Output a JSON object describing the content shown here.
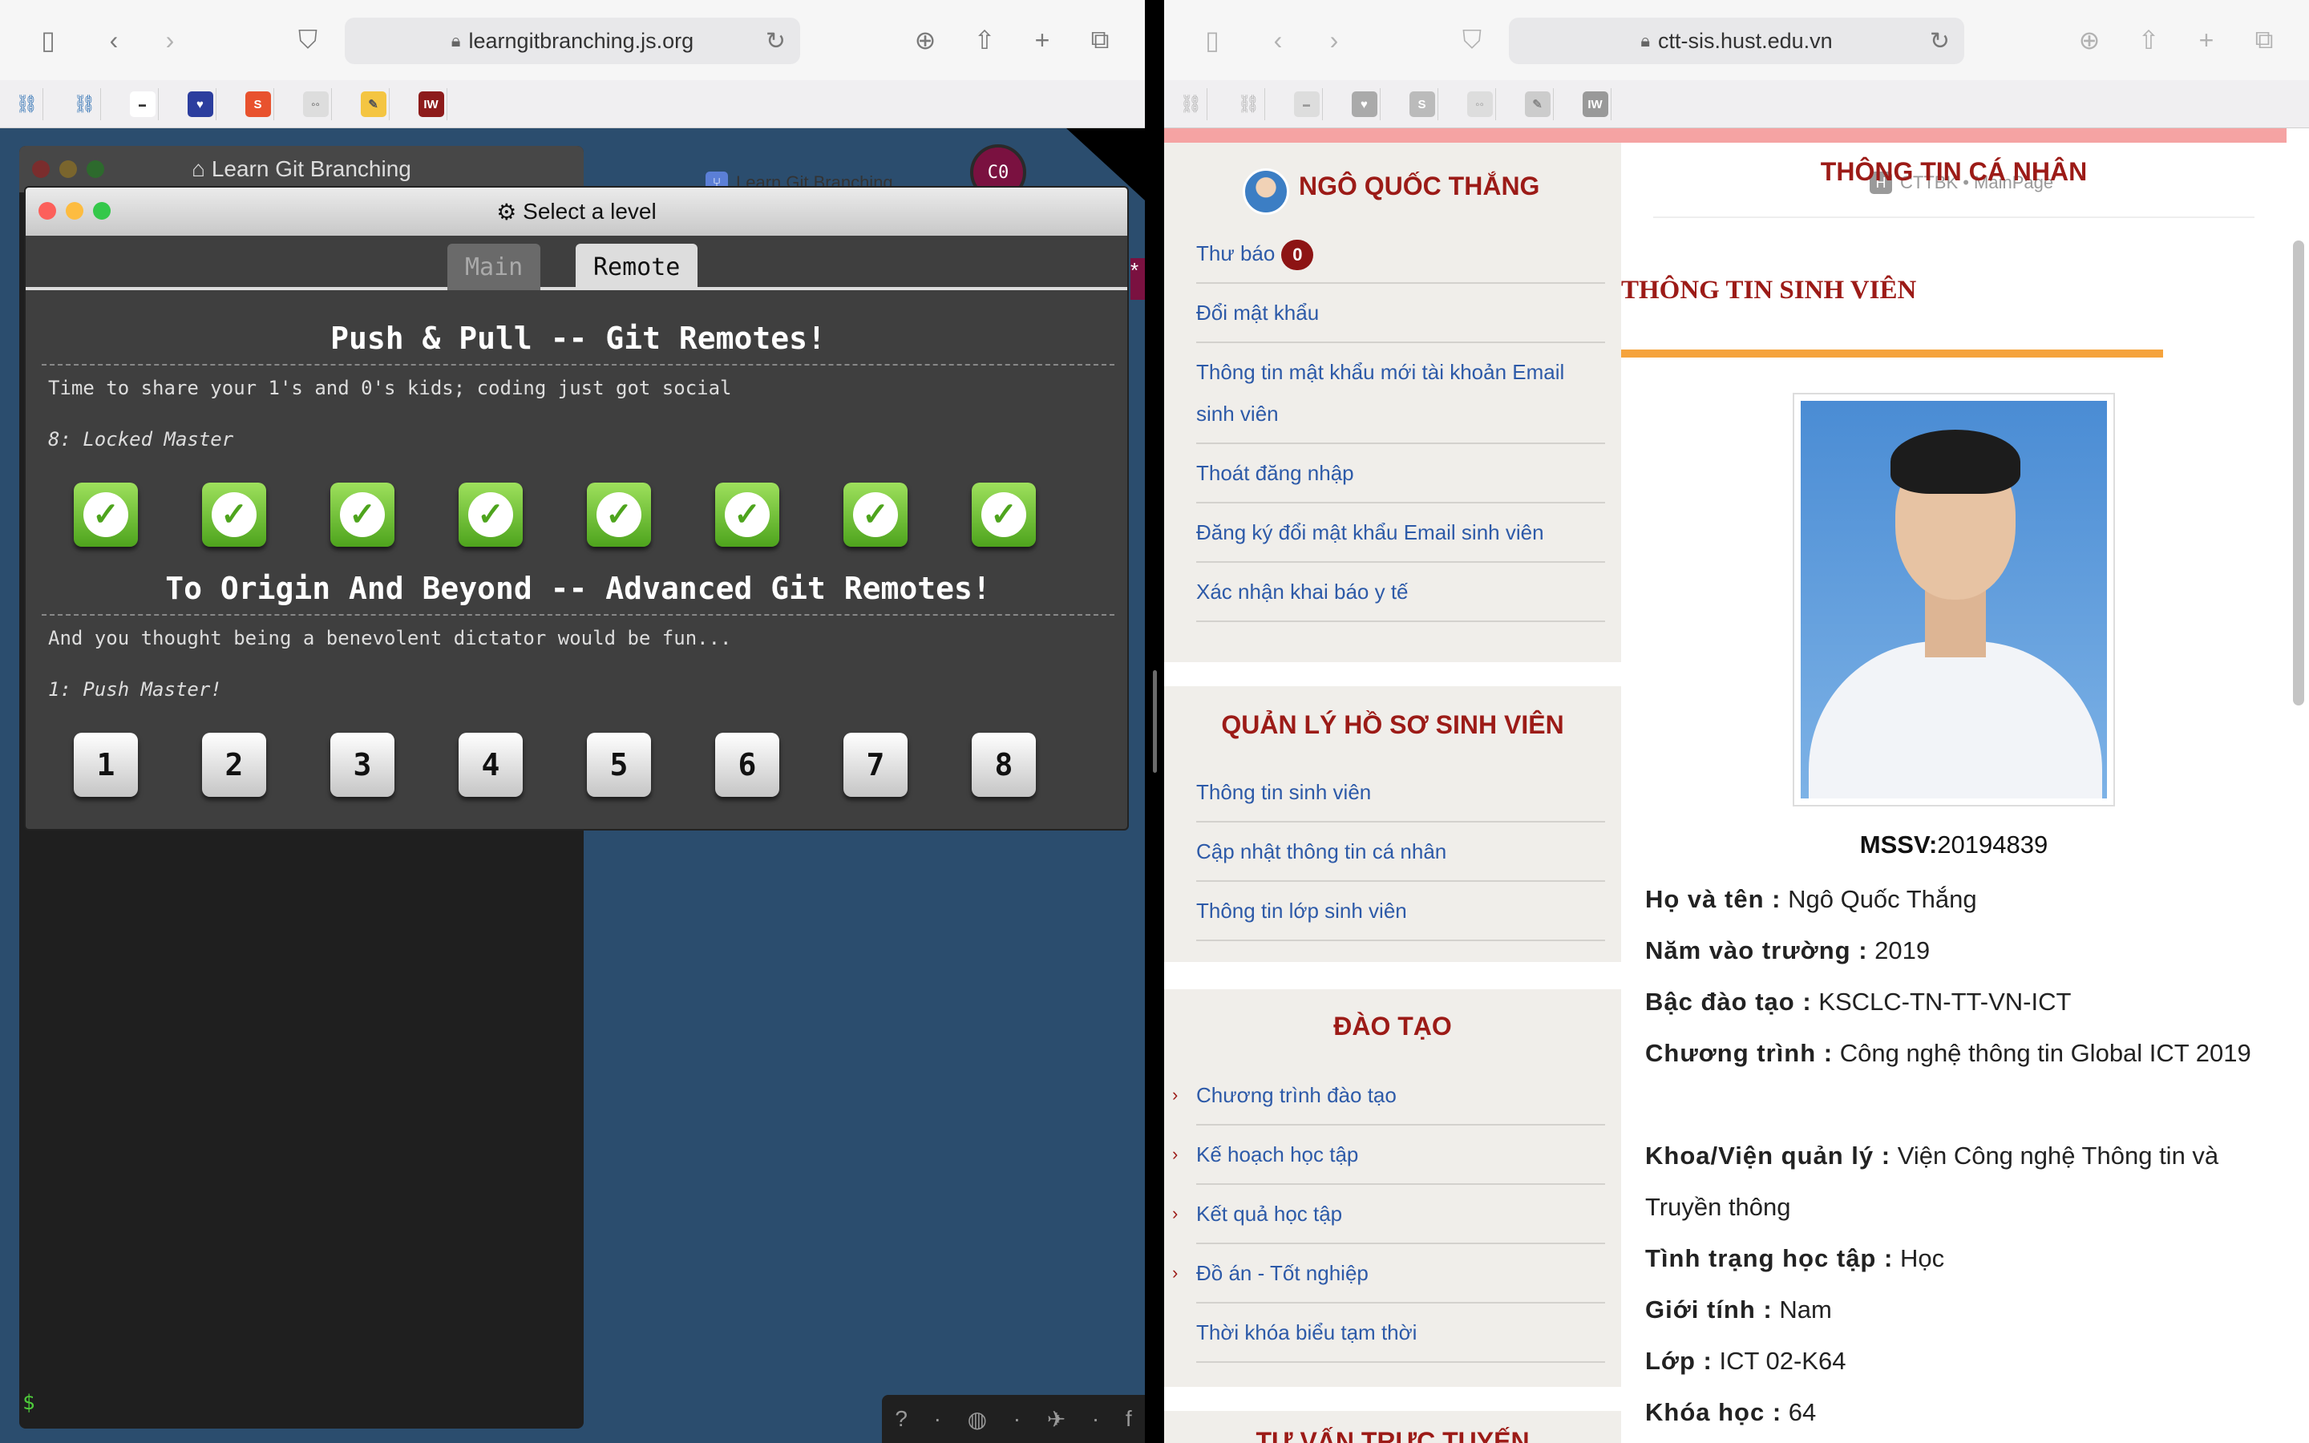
{
  "left_browser": {
    "url": "learngitbranching.js.org",
    "tab_title": "Learn Git Branching",
    "back_window_title": "Learn Git Branching",
    "modal_title": "Select a level",
    "tabs": [
      {
        "label": "Main",
        "active": false
      },
      {
        "label": "Remote",
        "active": true
      }
    ],
    "sequences": [
      {
        "title": "Push & Pull -- Git Remotes!",
        "description": "Time to share your 1's and 0's kids; coding just got social",
        "selected_level": "8: Locked Master",
        "levels": [
          "done",
          "done",
          "done",
          "done",
          "done",
          "done",
          "done",
          "done"
        ]
      },
      {
        "title": "To Origin And Beyond -- Advanced Git Remotes!",
        "description": "And you thought being a benevolent dictator would be fun...",
        "selected_level": "1: Push Master!",
        "levels": [
          "1",
          "2",
          "3",
          "4",
          "5",
          "6",
          "7",
          "8"
        ]
      }
    ],
    "commit_badge": "C0",
    "prompt": "$",
    "colors": {
      "done_green": "#4ea41d",
      "background": "#2b4d6e",
      "modal_bg": "#3f3f3f"
    }
  },
  "right_browser": {
    "url": "ctt-sis.hust.edu.vn",
    "tab_title": "CTTBK • MainPage",
    "tab_icon_letter": "H",
    "user_name": "NGÔ QUỐC THẮNG",
    "account_menu": [
      {
        "label": "Thư báo",
        "badge": "0"
      },
      {
        "label": "Đổi mật khẩu"
      },
      {
        "label": "Thông tin mật khẩu mới tài khoản Email sinh viên"
      },
      {
        "label": "Thoát đăng nhập"
      },
      {
        "label": "Đăng ký đổi mật khẩu Email sinh viên"
      },
      {
        "label": "Xác nhận khai báo y tế"
      }
    ],
    "profile_section": {
      "title": "QUẢN LÝ HỒ SƠ SINH VIÊN",
      "items": [
        "Thông tin sinh viên",
        "Cập nhật thông tin cá nhân",
        "Thông tin lớp sinh viên"
      ]
    },
    "training_section": {
      "title": "ĐÀO TẠO",
      "items": [
        "Chương trình đào tạo",
        "Kế hoạch học tập",
        "Kết quả học tập",
        "Đồ án - Tốt nghiệp",
        "Thời khóa biểu tạm thời"
      ]
    },
    "cut_off_heading": "TƯ VẤN TRỰC TUYẾN",
    "page_title": "THÔNG TIN CÁ NHÂN",
    "student_info_title": "THÔNG TIN SINH VIÊN",
    "mssv_label": "MSSV:",
    "mssv_value": "20194839",
    "fields": [
      {
        "label": "Họ và tên :",
        "value": "Ngô Quốc Thắng"
      },
      {
        "label": "Năm vào trường :",
        "value": "2019"
      },
      {
        "label": "Bậc đào tạo :",
        "value": "KSCLC-TN-TT-VN-ICT"
      },
      {
        "label": "Chương trình :",
        "value": "Công nghệ thông tin Global ICT 2019"
      },
      {
        "label": "Khoa/Viện quản lý :",
        "value": "Viện Công nghệ Thông tin và Truyền thông"
      },
      {
        "label": "Tình trạng học tập :",
        "value": "Học"
      },
      {
        "label": "Giới tính :",
        "value": "Nam"
      },
      {
        "label": "Lớp :",
        "value": "ICT 02-K64"
      },
      {
        "label": "Khóa học :",
        "value": "64"
      }
    ],
    "colors": {
      "heading_red": "#9c1b17",
      "link_blue": "#2d5aa8",
      "accent_orange": "#f5a33c",
      "sidebar_bg": "#f0eeea"
    }
  }
}
